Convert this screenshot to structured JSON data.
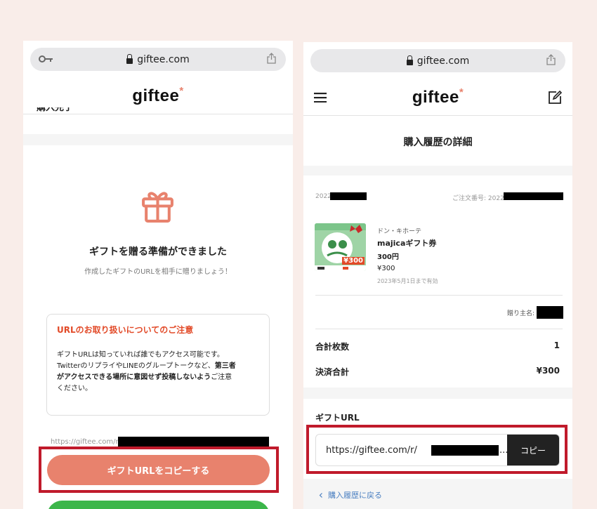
{
  "left": {
    "browser": {
      "domain": "giftee.com"
    },
    "header": {
      "logo": "giftee",
      "logo_mark": "*"
    },
    "cutoff_text": "購入完了",
    "gift": {
      "title": "ギフトを贈る準備ができました",
      "subtitle": "作成したギフトのURLを相手に贈りましょう！"
    },
    "notice": {
      "title": "URLのお取り扱いについてのご注意",
      "line1": "ギフトURLは知っていれば誰でもアクセス可能です。",
      "line2_a": "TwitterのリプライやLINEのグループトークなど、",
      "line2_b": "第三者",
      "line3": "がアクセスできる場所に意図せず投稿しないよう",
      "line3_b": "ご注意",
      "line4": "ください。"
    },
    "url_prefix": "https://giftee.com/r/",
    "copy_button": "ギフトURLをコピーする"
  },
  "right": {
    "browser": {
      "domain": "giftee.com"
    },
    "header": {
      "logo": "giftee",
      "logo_mark": "*"
    },
    "page_title": "購入履歴の詳細",
    "order": {
      "date_prefix": "2022/",
      "order_no_label": "ご注文番号: 2022",
      "brand": "ドン・キホーテ",
      "product": "majicaギフト券",
      "amount": "300円",
      "price": "¥300",
      "expiry": "2023年5月1日まで有効",
      "card_price": "¥300",
      "recipient_label": "贈り主名:"
    },
    "summary": {
      "count_label": "合計枚数",
      "count_value": "1",
      "total_label": "決済合計",
      "total_value": "¥300"
    },
    "gift_url": {
      "label": "ギフトURL",
      "url_prefix": "https://giftee.com/r/",
      "url_suffix": "...",
      "copy_button": "コピー"
    },
    "back_link": "購入履歴に戻る"
  },
  "colors": {
    "accent": "#e8826d",
    "alert": "#e24a28",
    "highlight": "#c01a2b",
    "green": "#3cb64a"
  }
}
